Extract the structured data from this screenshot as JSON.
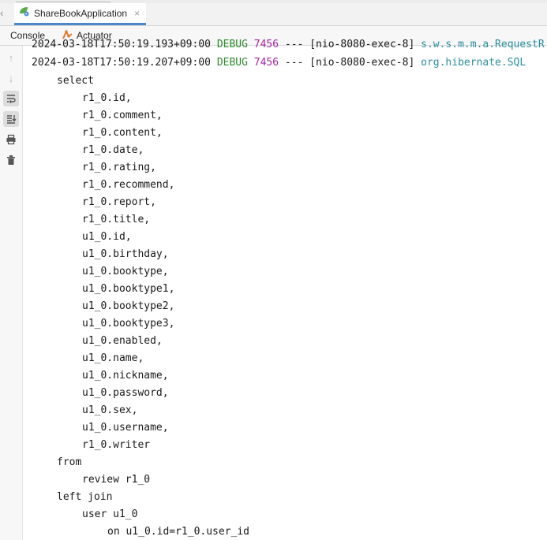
{
  "run_tab": {
    "title": "ShareBookApplication",
    "close": "×"
  },
  "subtabs": [
    {
      "label": "Console"
    },
    {
      "label": "Actuator"
    }
  ],
  "toolbar_icons": [
    "up-arrow-icon",
    "down-arrow-icon",
    "soft-wrap-icon",
    "scroll-to-end-icon",
    "print-icon",
    "trash-icon"
  ],
  "log": {
    "line1": {
      "ts": "2024-03-18T17:50:19.193+09:00",
      "level": "DEBUG",
      "pid": "7456",
      "sep": "---",
      "thread": "[nio-8080-exec-8]",
      "logger": "s.w.s.m.m.a.RequestR"
    },
    "line2": {
      "ts": "2024-03-18T17:50:19.207+09:00",
      "level": "DEBUG",
      "pid": "7456",
      "sep": "---",
      "thread": "[nio-8080-exec-8]",
      "logger": "org.hibernate.SQL"
    }
  },
  "sql": [
    "select",
    "r1_0.id,",
    "r1_0.comment,",
    "r1_0.content,",
    "r1_0.date,",
    "r1_0.rating,",
    "r1_0.recommend,",
    "r1_0.report,",
    "r1_0.title,",
    "u1_0.id,",
    "u1_0.birthday,",
    "u1_0.booktype,",
    "u1_0.booktype1,",
    "u1_0.booktype2,",
    "u1_0.booktype3,",
    "u1_0.enabled,",
    "u1_0.name,",
    "u1_0.nickname,",
    "u1_0.password,",
    "u1_0.sex,",
    "u1_0.username,",
    "r1_0.writer",
    "from",
    "review r1_0",
    "left join",
    "user u1_0",
    "on u1_0.id=r1_0.user_id"
  ]
}
